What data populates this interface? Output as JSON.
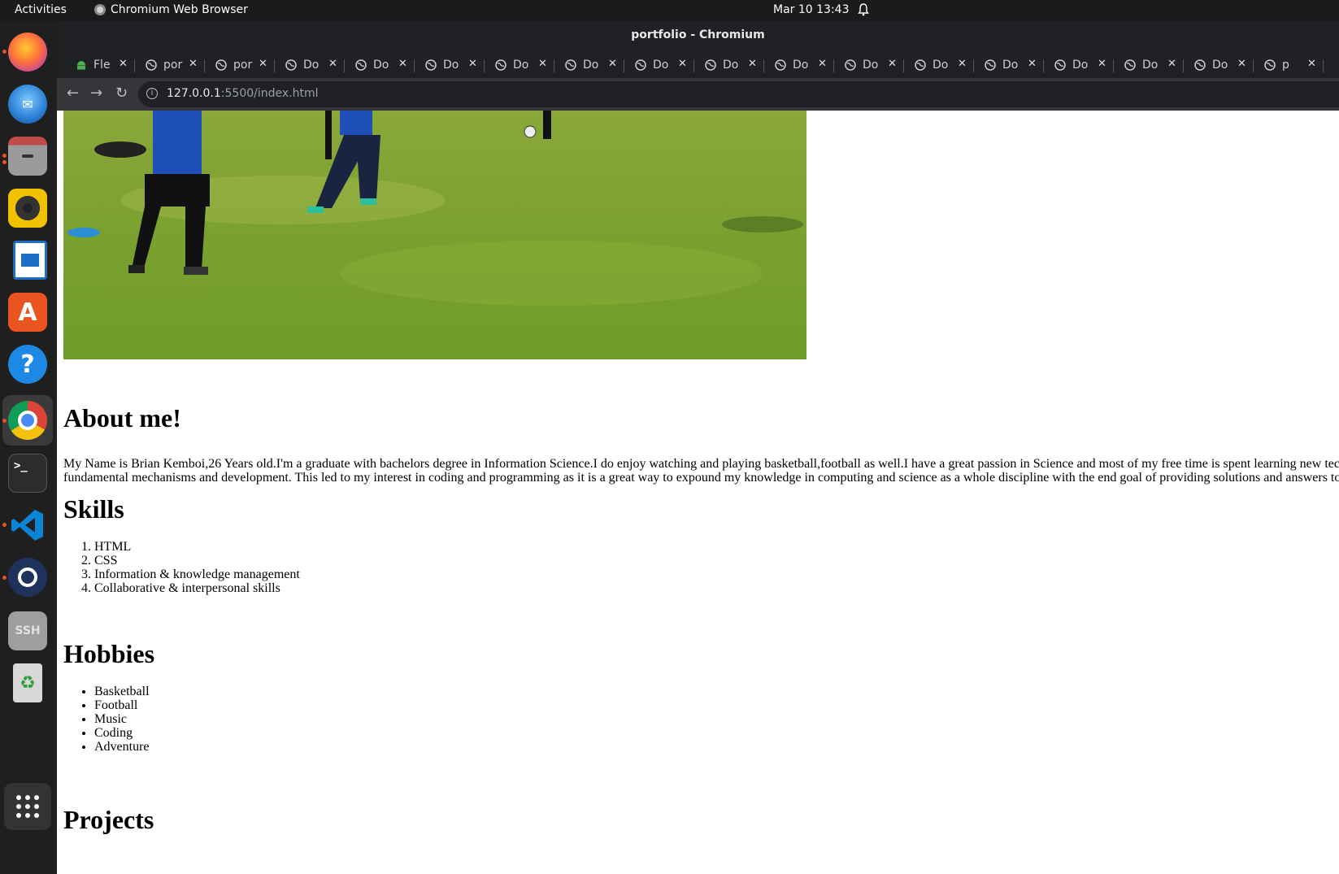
{
  "topbar": {
    "activities": "Activities",
    "app_name": "Chromium Web Browser",
    "clock": "Mar 10  13:43"
  },
  "dock": {
    "items": [
      {
        "name": "firefox",
        "color": "#ff7139"
      },
      {
        "name": "thunderbird",
        "color": "#2a7fd4"
      },
      {
        "name": "files",
        "color": "#8c8c8c"
      },
      {
        "name": "rhythmbox",
        "color": "#f2c200"
      },
      {
        "name": "libreoffice-writer",
        "color": "#1d6ec5"
      },
      {
        "name": "ubuntu-software",
        "color": "#e95420"
      },
      {
        "name": "help",
        "color": "#1e88e5"
      },
      {
        "name": "chromium",
        "color": "#4a8af4"
      },
      {
        "name": "terminal",
        "color": "#2c2c2c"
      },
      {
        "name": "vscode",
        "color": "#0078d4"
      },
      {
        "name": "mattermost",
        "color": "#1e325c"
      },
      {
        "name": "ssh-keys",
        "color": "#9e9e9e"
      },
      {
        "name": "trash",
        "color": "#d8d8d8"
      }
    ],
    "apps_grid": "show-apps"
  },
  "browser": {
    "window_title": "portfolio - Chromium",
    "tabs": [
      {
        "title": "Fle",
        "favicon": "android-icon"
      },
      {
        "title": "por",
        "favicon": "globe-icon"
      },
      {
        "title": "por",
        "favicon": "globe-icon"
      },
      {
        "title": "Do",
        "favicon": "globe-icon"
      },
      {
        "title": "Do",
        "favicon": "globe-icon"
      },
      {
        "title": "Do",
        "favicon": "globe-icon"
      },
      {
        "title": "Do",
        "favicon": "globe-icon"
      },
      {
        "title": "Do",
        "favicon": "globe-icon"
      },
      {
        "title": "Do",
        "favicon": "globe-icon"
      },
      {
        "title": "Do",
        "favicon": "globe-icon"
      },
      {
        "title": "Do",
        "favicon": "globe-icon"
      },
      {
        "title": "Do",
        "favicon": "globe-icon"
      },
      {
        "title": "Do",
        "favicon": "globe-icon"
      },
      {
        "title": "Do",
        "favicon": "globe-icon"
      },
      {
        "title": "Do",
        "favicon": "globe-icon"
      },
      {
        "title": "Do",
        "favicon": "globe-icon"
      },
      {
        "title": "Do",
        "favicon": "globe-icon"
      },
      {
        "title": "p",
        "favicon": "globe-icon"
      }
    ],
    "url_host": "127.0.0.1",
    "url_rest": ":5500/index.html"
  },
  "page": {
    "about_heading": "About me!",
    "about_line1": "My Name is Brian Kemboi,26 Years old.I'm a graduate with bachelors degree in Information Science.I do enjoy watching and playing basketball,football as well.I have a great passion in Science and most of my free time is spent learning new tec",
    "about_line2": "fundamental mechanisms and development. This led to my interest in coding and programming as it is a great way to expound my knowledge in computing and science as a whole discipline with the end goal of providing solutions and answers to",
    "skills_heading": "Skills",
    "skills": [
      "HTML",
      "CSS",
      "Information & knowledge management",
      "Collaborative & interpersonal skills"
    ],
    "hobbies_heading": "Hobbies",
    "hobbies": [
      "Basketball",
      "Football",
      "Music",
      "Coding",
      "Adventure"
    ],
    "projects_heading": "Projects"
  }
}
